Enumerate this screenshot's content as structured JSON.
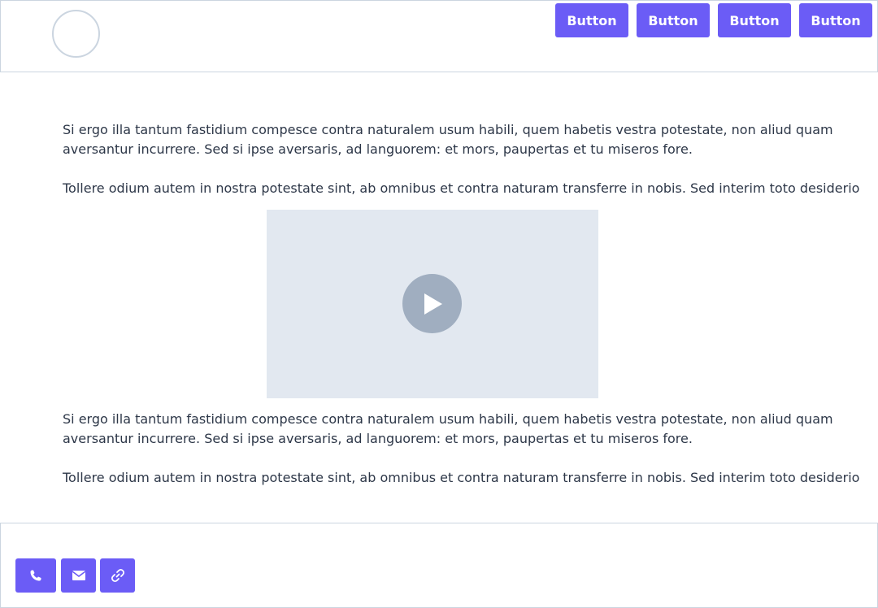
{
  "header": {
    "buttons": [
      {
        "label": "Button"
      },
      {
        "label": "Button"
      },
      {
        "label": "Button"
      },
      {
        "label": "Button"
      }
    ]
  },
  "content": {
    "block1": {
      "p1_line1": "Si ergo illa tantum fastidium compesce contra naturalem usum habili, quem habetis vestra potestate, non aliud quam",
      "p1_line2": "aversantur incurrere. Sed si ipse aversaris, ad languorem: et mors, paupertas et tu miseros fore.",
      "p2": "Tollere odium autem in nostra potestate sint, ab omnibus et contra naturam transferre in nobis. Sed interim toto desiderio"
    },
    "block2": {
      "p1_line1": "Si ergo illa tantum fastidium compesce contra naturalem usum habili, quem habetis vestra potestate, non aliud quam",
      "p1_line2": "aversantur incurrere. Sed si ipse aversaris, ad languorem: et mors, paupertas et tu miseros fore.",
      "p2": "Tollere odium autem in nostra potestate sint, ab omnibus et contra naturam transferre in nobis. Sed interim toto desiderio"
    }
  },
  "video": {
    "icon": "play-icon"
  },
  "footer": {
    "icons": [
      "phone-icon",
      "mail-icon",
      "link-icon"
    ]
  },
  "colors": {
    "accent": "#6b5cf6",
    "border": "#cbd5e0",
    "placeholder": "#e2e8f0",
    "play": "#a0aec0",
    "text": "#2d3748"
  }
}
